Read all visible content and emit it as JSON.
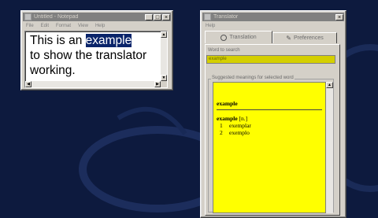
{
  "notepad": {
    "title": "Untitled - Notepad",
    "menu": [
      "File",
      "Edit",
      "Format",
      "View",
      "Help"
    ],
    "text_before": "This is an ",
    "text_selected": "example",
    "text_after": "to show the translator working."
  },
  "translator": {
    "title": "Translator",
    "menu": [
      "Help"
    ],
    "tabs": [
      {
        "label": "Translation",
        "icon": "globe-icon",
        "active": true
      },
      {
        "label": "Preferences",
        "icon": "tools-icon",
        "active": false
      }
    ],
    "search_label": "Word to search",
    "search_value": "example",
    "results_label": "Suggested meanings for selected word",
    "result": {
      "headword": "example",
      "entry_word": "example",
      "part_of_speech": "[n.]",
      "meanings": [
        {
          "num": "1",
          "text": "exemplar"
        },
        {
          "num": "2",
          "text": "exemplo"
        }
      ]
    }
  },
  "colors": {
    "desktop": "#0d1a3e",
    "selection": "#0a246a",
    "results_bg": "#ffff00",
    "search_bg": "#d4cf00"
  }
}
